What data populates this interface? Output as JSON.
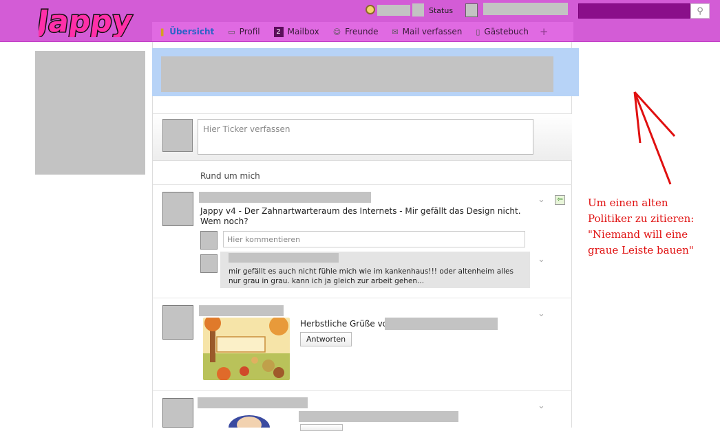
{
  "brand": {
    "logo_text": "Jappy"
  },
  "header": {
    "status_label": "Status"
  },
  "search": {
    "placeholder": ""
  },
  "nav": {
    "items": [
      {
        "label": "Übersicht",
        "icon": "lightbulb-icon",
        "active": true
      },
      {
        "label": "Profil",
        "icon": "id-card-icon"
      },
      {
        "label": "Mailbox",
        "icon": "mailbox-badge",
        "badge": "2"
      },
      {
        "label": "Freunde",
        "icon": "friends-icon"
      },
      {
        "label": "Mail verfassen",
        "icon": "envelope-icon"
      },
      {
        "label": "Gästebuch",
        "icon": "book-icon"
      }
    ],
    "more": "+"
  },
  "ticker": {
    "placeholder": "Hier Ticker verfassen"
  },
  "feed": {
    "section_title": "Rund um mich",
    "post1": {
      "text": "Jappy v4 - Der Zahnartwarteraum des Internets - Mir gefällt das Design nicht. Wem noch?",
      "comment_placeholder": "Hier kommentieren",
      "comment_text": "mir gefällt es auch nicht fühle mich wie im kankenhaus!!! oder altenheim alles nur grau in grau. kann ich ja gleich zur arbeit gehen..."
    },
    "post2": {
      "text": "Herbstliche Grüße von",
      "reply_label": "Antworten"
    }
  },
  "annotation": {
    "text": "Um einen alten\nPolitiker zu zitieren:\n\"Niemand will eine\ngraue Leiste bauen\""
  },
  "colors": {
    "topbar": "#d35cd6",
    "nav": "#e06ae2",
    "search": "#8a0f8a",
    "band": "#b7d3f7",
    "annotation": "#e01010"
  }
}
